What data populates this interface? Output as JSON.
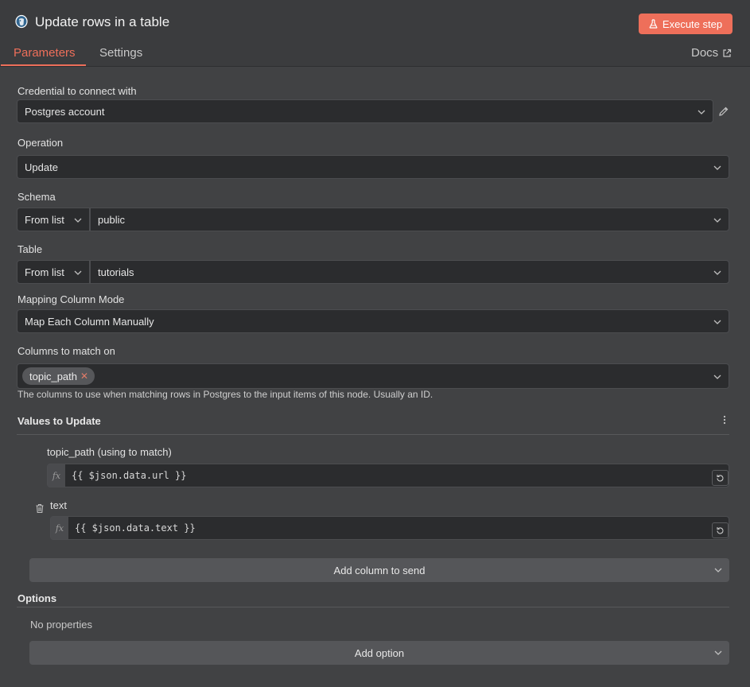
{
  "header": {
    "title": "Update rows in a table",
    "execute_label": "Execute step",
    "tabs": [
      "Parameters",
      "Settings"
    ],
    "docs_label": "Docs"
  },
  "credential": {
    "label": "Credential to connect with",
    "value": "Postgres account"
  },
  "operation": {
    "label": "Operation",
    "value": "Update"
  },
  "schema": {
    "label": "Schema",
    "mode": "From list",
    "value": "public"
  },
  "table": {
    "label": "Table",
    "mode": "From list",
    "value": "tutorials"
  },
  "mapping": {
    "label": "Mapping Column Mode",
    "value": "Map Each Column Manually"
  },
  "match_columns": {
    "label": "Columns to match on",
    "chips": [
      "topic_path"
    ],
    "hint": "The columns to use when matching rows in Postgres to the input items of this node. Usually an ID."
  },
  "values_to_update": {
    "title": "Values to Update",
    "fields": [
      {
        "label": "topic_path (using to match)",
        "expression": "{{ $json.data.url }}"
      },
      {
        "label": "text",
        "expression": "{{ $json.data.text }}"
      }
    ],
    "add_column_label": "Add column to send"
  },
  "options": {
    "title": "Options",
    "empty_label": "No properties",
    "add_option_label": "Add option"
  },
  "colors": {
    "accent": "#ee6f5a",
    "background": "#414244",
    "input": "#2b2c2e"
  }
}
